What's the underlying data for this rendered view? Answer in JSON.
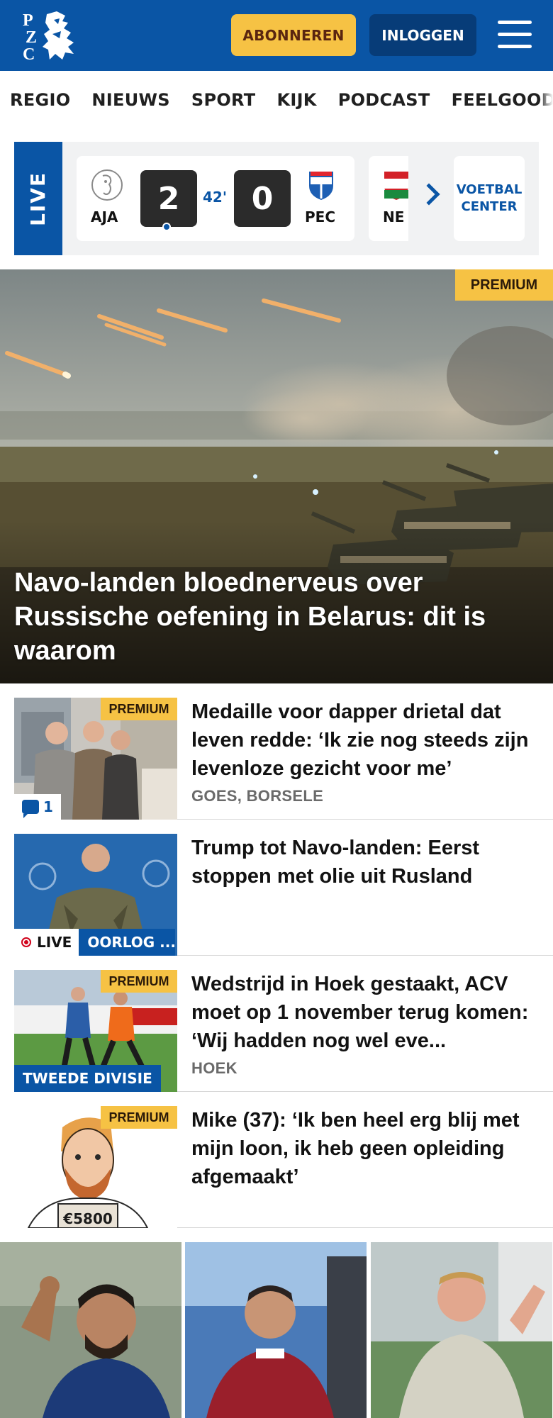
{
  "header": {
    "logo_letters": [
      "P",
      "Z",
      "C"
    ],
    "subscribe_label": "ABONNEREN",
    "login_label": "INLOGGEN",
    "colors": {
      "brand_blue": "#0a55a5",
      "dark_blue": "#073c78",
      "accent_yellow": "#f6c244"
    }
  },
  "nav": {
    "items": [
      "REGIO",
      "NIEUWS",
      "SPORT",
      "KIJK",
      "PODCAST",
      "FEELGOOD"
    ]
  },
  "live": {
    "tag": "LIVE",
    "match": {
      "home": "AJA",
      "home_score": "2",
      "minute": "42'",
      "away_score": "0",
      "away": "PEC"
    },
    "next_match_home": "NE",
    "center_label_1": "VOETBAL",
    "center_label_2": "CENTER"
  },
  "hero": {
    "badge": "PREMIUM",
    "title": "Navo-landen bloednerveus over Russische oefening in Belarus: dit is waarom"
  },
  "articles": [
    {
      "badge": "PREMIUM",
      "comments": "1",
      "title": "Medaille voor dapper drietal dat leven redde: ‘Ik zie nog steeds zijn levenloze gezicht voor me’",
      "location": "GOES, BORSELE"
    },
    {
      "live_label": "LIVE",
      "category": "OORLOG ...",
      "title": "Trump tot Navo-landen: Eerst stoppen met olie uit Rusland"
    },
    {
      "badge": "PREMIUM",
      "category": "TWEEDE DIVISIE",
      "title": "Wedstrijd in Hoek gestaakt, ACV moet op 1 november terug komen: ‘Wij hadden nog wel eve...",
      "location": "HOEK"
    },
    {
      "badge": "PREMIUM",
      "price_sign": "€5800",
      "title": "Mike (37): ‘Ik ben heel erg blij met mijn loon, ik heb geen opleiding afgemaakt’"
    }
  ]
}
